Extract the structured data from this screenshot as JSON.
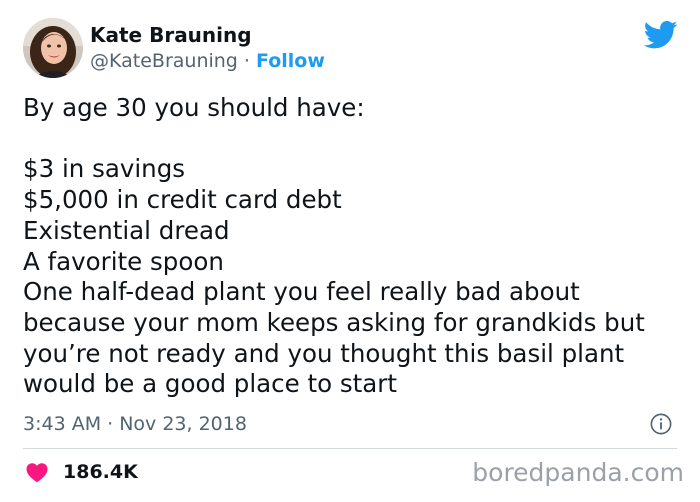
{
  "author": {
    "name": "Kate Brauning",
    "handle": "@KateBrauning",
    "separator": "·",
    "follow_label": "Follow"
  },
  "tweet": {
    "lines": [
      "By age 30 you should have:",
      "",
      "$3 in savings",
      "$5,000 in credit card debt",
      "Existential dread",
      "A favorite spoon",
      "One half-dead plant you feel really bad about",
      "because your mom keeps asking for grandkids but",
      "you’re not ready and you thought this basil plant",
      "would be a good place to start"
    ],
    "timestamp": "3:43 AM · Nov 23, 2018"
  },
  "engagement": {
    "like_count": "186.4K"
  },
  "watermark": "boredpanda.com",
  "icons": {
    "logo": "twitter-bird-icon",
    "info": "info-icon",
    "like": "heart-icon"
  },
  "colors": {
    "accent": "#1d9bf0",
    "heart": "#f91880",
    "text": "#0f1419",
    "secondary": "#536471"
  }
}
